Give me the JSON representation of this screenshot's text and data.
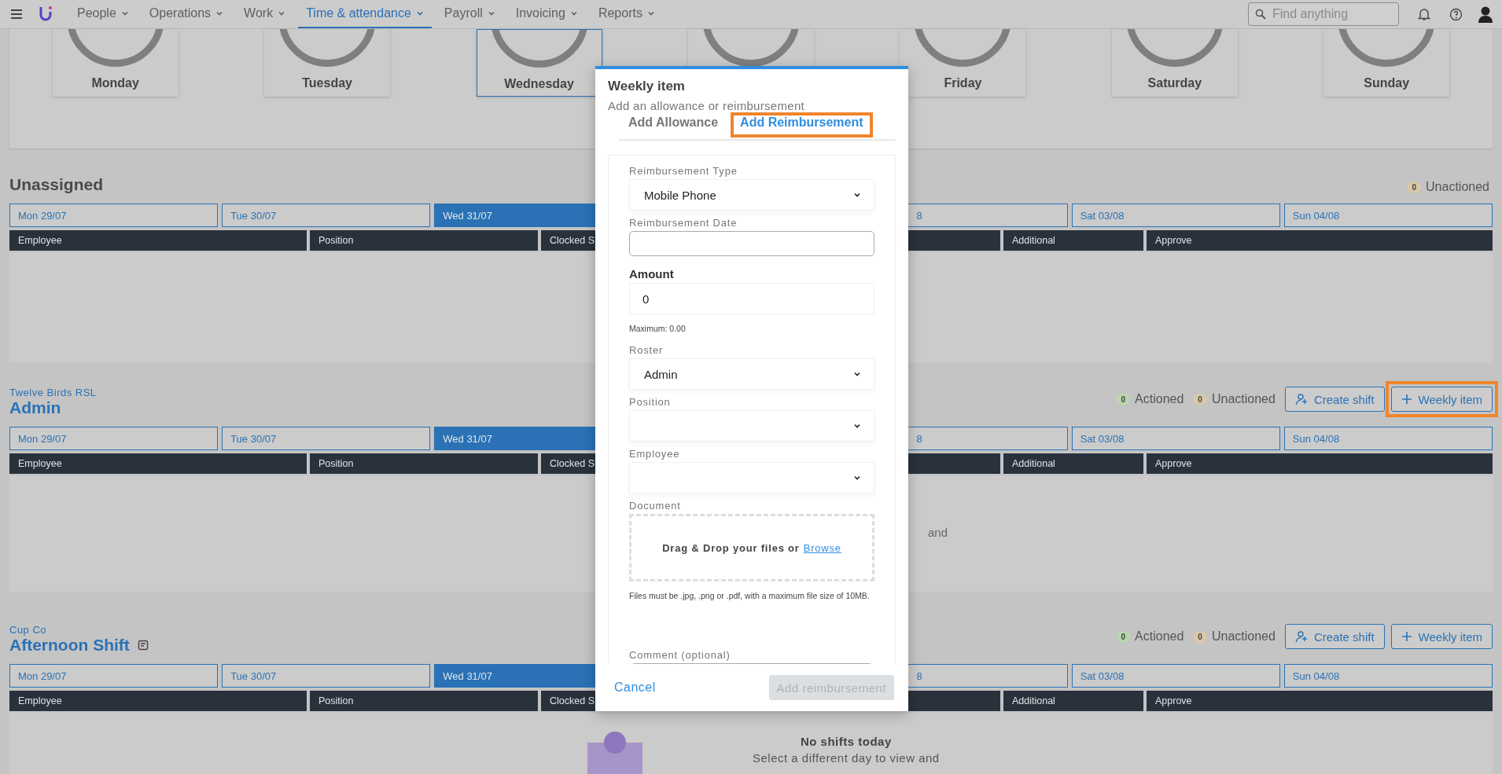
{
  "nav": {
    "items": [
      {
        "label": "People",
        "selected": false
      },
      {
        "label": "Operations",
        "selected": false
      },
      {
        "label": "Work",
        "selected": false
      },
      {
        "label": "Time & attendance",
        "selected": true
      },
      {
        "label": "Payroll",
        "selected": false
      },
      {
        "label": "Invoicing",
        "selected": false
      },
      {
        "label": "Reports",
        "selected": false
      }
    ],
    "search": {
      "placeholder": "Find anything"
    }
  },
  "days": [
    {
      "label": "Monday",
      "selected": false
    },
    {
      "label": "Tuesday",
      "selected": false
    },
    {
      "label": "Wednesday",
      "selected": true
    },
    {
      "selected": false
    },
    {
      "label": "Friday",
      "selected": false
    },
    {
      "label": "Saturday",
      "selected": false
    },
    {
      "label": "Sunday",
      "selected": false
    }
  ],
  "sections": [
    {
      "title": "Unassigned",
      "counts": [
        {
          "count": "0",
          "label": "Unactioned",
          "color": "#d8c7a8"
        }
      ],
      "tabs": [
        {
          "label": "Mon 29/07",
          "selected": false
        },
        {
          "label": "Tue 30/07",
          "selected": false
        },
        {
          "label": "Wed 31/07",
          "selected": true
        },
        {
          "label": "8",
          "kind": "cut",
          "selected": false
        },
        {
          "label": "Sat 03/08",
          "selected": false
        },
        {
          "label": "Sun 04/08",
          "selected": false
        }
      ],
      "columns": [
        "Employee",
        "Position",
        "Clocked S",
        "",
        "Additional",
        "Approve"
      ]
    },
    {
      "subtitle": "Twelve Birds RSL",
      "title": "Admin",
      "counts": [
        {
          "count": "0",
          "label": "Actioned",
          "color": "#b9d6ae"
        },
        {
          "count": "0",
          "label": "Unactioned",
          "color": "#d8c7a8"
        }
      ],
      "buttons": [
        {
          "label": "Create shift",
          "kind": "person",
          "highlighted": false
        },
        {
          "label": "Weekly item",
          "kind": "plus",
          "highlighted": true
        }
      ],
      "tabs": [
        {
          "label": "Mon 29/07",
          "selected": false
        },
        {
          "label": "Tue 30/07",
          "selected": false
        },
        {
          "label": "Wed 31/07",
          "selected": true
        },
        {
          "label": "8",
          "kind": "cut",
          "selected": false
        },
        {
          "label": "Sat 03/08",
          "selected": false
        },
        {
          "label": "Sun 04/08",
          "selected": false
        }
      ],
      "columns": [
        "Employee",
        "Position",
        "Clocked S",
        "",
        "Additional",
        "Approve"
      ],
      "empty": {
        "text_cut": "and"
      }
    },
    {
      "subtitle": "Cup Co",
      "title": "Afternoon Shift",
      "note_icon": true,
      "counts": [
        {
          "count": "0",
          "label": "Actioned",
          "color": "#b9d6ae"
        },
        {
          "count": "0",
          "label": "Unactioned",
          "color": "#d8c7a8"
        }
      ],
      "buttons": [
        {
          "label": "Create shift",
          "kind": "person",
          "highlighted": false
        },
        {
          "label": "Weekly item",
          "kind": "plus",
          "highlighted": false
        }
      ],
      "tabs": [
        {
          "label": "Mon 29/07",
          "selected": false
        },
        {
          "label": "Tue 30/07",
          "selected": false
        },
        {
          "label": "Wed 31/07",
          "selected": true
        },
        {
          "label": "8",
          "kind": "cut",
          "selected": false
        },
        {
          "label": "Sat 03/08",
          "selected": false
        },
        {
          "label": "Sun 04/08",
          "selected": false
        }
      ],
      "columns": [
        "Employee",
        "Position",
        "Clocked S",
        "",
        "Additional",
        "Approve"
      ],
      "empty": {
        "title": "No shifts today",
        "text": "Select a different day to view and"
      }
    }
  ],
  "modal": {
    "title": "Weekly item",
    "subtitle": "Add an allowance or reimbursement",
    "tabs": [
      {
        "label": "Add Allowance",
        "selected": false,
        "highlighted": false
      },
      {
        "label": "Add Reimbursement",
        "selected": true,
        "highlighted": true
      }
    ],
    "fields": [
      {
        "kind": "select",
        "label": "Reimbursement Type",
        "value": "Mobile Phone"
      },
      {
        "kind": "input",
        "label": "Reimbursement Date"
      },
      {
        "kind": "number",
        "label": "Amount",
        "emphasis": true,
        "value": "0",
        "hint": "Maximum: 0.00"
      },
      {
        "kind": "select",
        "label": "Roster",
        "value": "Admin"
      },
      {
        "kind": "select",
        "label": "Position"
      },
      {
        "kind": "select",
        "label": "Employee"
      },
      {
        "kind": "file",
        "label": "Document",
        "drop_text": "Drag & Drop your files or",
        "link": "Browse",
        "hint": "Files must be .jpg, .png or .pdf, with a maximum file size of 10MB."
      },
      {
        "kind": "textarea",
        "label": "Comment (optional)"
      }
    ],
    "cancel": "Cancel",
    "submit": {
      "label": "Add reimbursement",
      "disabled": true
    }
  }
}
